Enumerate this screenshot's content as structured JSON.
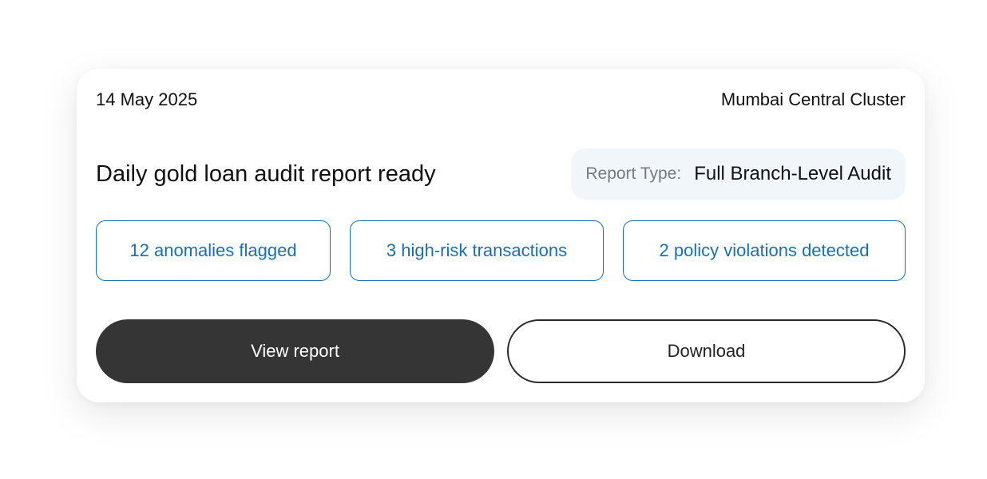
{
  "header": {
    "date": "14 May 2025",
    "cluster": "Mumbai Central Cluster"
  },
  "title": "Daily gold loan audit report ready",
  "report_type": {
    "label": "Report Type:",
    "value": "Full Branch-Level Audit"
  },
  "chips": [
    {
      "label": "12 anomalies flagged"
    },
    {
      "label": "3 high-risk transactions"
    },
    {
      "label": "2 policy violations detected"
    }
  ],
  "actions": {
    "view_label": "View report",
    "download_label": "Download"
  },
  "colors": {
    "accent": "#1670b4",
    "primary_button": "#353535",
    "report_type_bg": "#f1f6fb"
  }
}
